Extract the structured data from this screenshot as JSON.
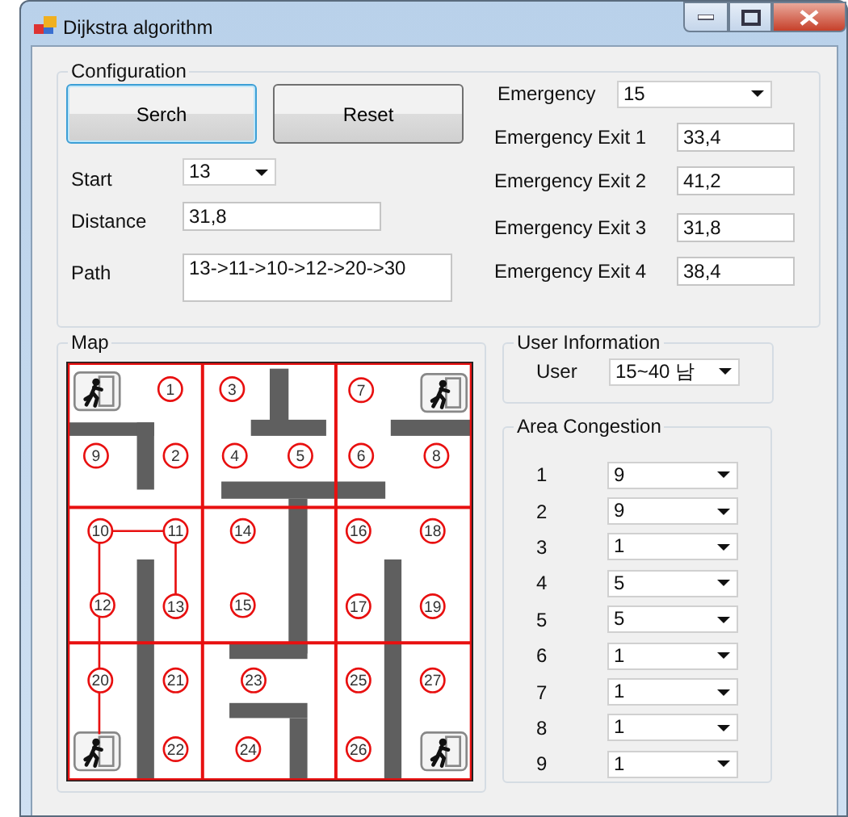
{
  "window": {
    "title": "Dijkstra algorithm"
  },
  "configuration": {
    "title": "Configuration",
    "buttons": [
      {
        "label": "Serch",
        "focused": true
      },
      {
        "label": "Reset",
        "focused": false
      }
    ],
    "fields": [
      {
        "label": "Start",
        "kind": "dropdown",
        "value": "13"
      },
      {
        "label": "Distance",
        "kind": "text",
        "value": "31,8"
      },
      {
        "label": "Path",
        "kind": "textarea",
        "value": "13->11->10->12->20->30"
      }
    ],
    "emergency": {
      "label": "Emergency",
      "value": "15"
    },
    "exits": [
      {
        "label": "Emergency Exit 1",
        "value": "33,4"
      },
      {
        "label": "Emergency Exit 2",
        "value": "41,2"
      },
      {
        "label": "Emergency Exit 3",
        "value": "31,8"
      },
      {
        "label": "Emergency Exit 4",
        "value": "38,4"
      }
    ]
  },
  "map": {
    "title": "Map",
    "nodes": [
      {
        "label": "1"
      },
      {
        "label": "3"
      },
      {
        "label": "7"
      },
      {
        "label": "9"
      },
      {
        "label": "2"
      },
      {
        "label": "4"
      },
      {
        "label": "5"
      },
      {
        "label": "6"
      },
      {
        "label": "8"
      },
      {
        "label": "10"
      },
      {
        "label": "11"
      },
      {
        "label": "14"
      },
      {
        "label": "16"
      },
      {
        "label": "18"
      },
      {
        "label": "12"
      },
      {
        "label": "13"
      },
      {
        "label": "15"
      },
      {
        "label": "17"
      },
      {
        "label": "19"
      },
      {
        "label": "20"
      },
      {
        "label": "21"
      },
      {
        "label": "23"
      },
      {
        "label": "25"
      },
      {
        "label": "27"
      },
      {
        "label": "22"
      },
      {
        "label": "24"
      },
      {
        "label": "26"
      }
    ]
  },
  "user_information": {
    "title": "User Information",
    "label": "User",
    "value": "15~40 남"
  },
  "area_congestion": {
    "title": "Area Congestion",
    "areas": [
      {
        "label": "1",
        "value": "9"
      },
      {
        "label": "2",
        "value": "9"
      },
      {
        "label": "3",
        "value": "1"
      },
      {
        "label": "4",
        "value": "5"
      },
      {
        "label": "5",
        "value": "5"
      },
      {
        "label": "6",
        "value": "1"
      },
      {
        "label": "7",
        "value": "1"
      },
      {
        "label": "8",
        "value": "1"
      },
      {
        "label": "9",
        "value": "1"
      }
    ]
  }
}
